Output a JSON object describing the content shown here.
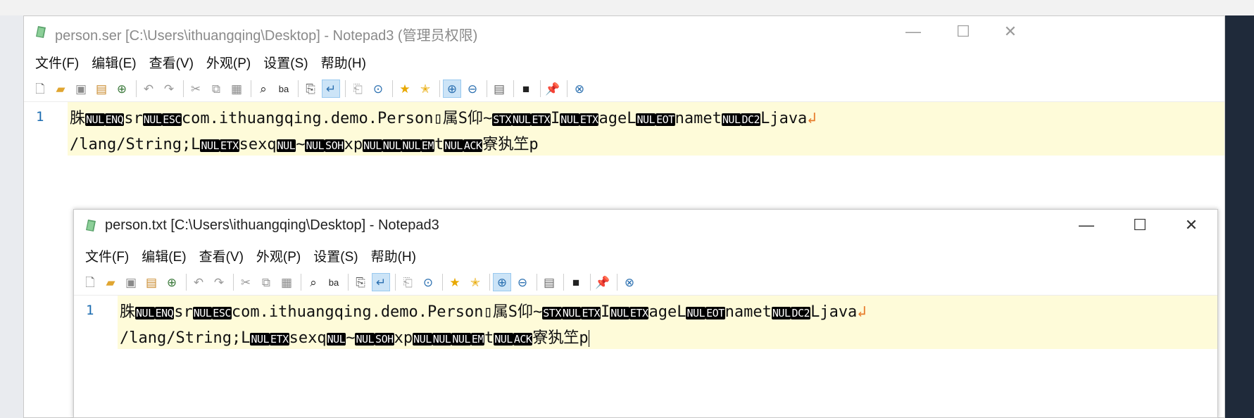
{
  "window_back": {
    "title": "person.ser [C:\\Users\\ithuangqing\\Desktop] - Notepad3  (管理员权限)",
    "line_number": "1"
  },
  "window_front": {
    "title": "person.txt [C:\\Users\\ithuangqing\\Desktop] - Notepad3",
    "line_number": "1"
  },
  "window_controls": {
    "minimize": "—",
    "maximize": "☐",
    "close": "✕"
  },
  "menu": [
    "文件(F)",
    "编辑(E)",
    "查看(V)",
    "外观(P)",
    "设置(S)",
    "帮助(H)"
  ],
  "toolbar_icons": [
    "new-file-icon",
    "open-folder-icon",
    "save-icon",
    "save-as-icon",
    "browse-icon",
    "undo-icon",
    "redo-icon",
    "cut-icon",
    "copy-icon",
    "paste-icon",
    "find-icon",
    "replace-icon",
    "goto-icon",
    "word-wrap-icon",
    "copy-all-icon",
    "find-next-icon",
    "favorites-icon",
    "add-favorite-icon",
    "zoom-in-icon",
    "zoom-out-icon",
    "settings-icon",
    "console-icon",
    "pin-icon",
    "exit-icon"
  ],
  "editor_content": {
    "line1": [
      {
        "t": "t",
        "v": "䏭"
      },
      {
        "t": "c",
        "v": "NUL"
      },
      {
        "t": "c",
        "v": "ENQ"
      },
      {
        "t": "t",
        "v": "sr"
      },
      {
        "t": "c",
        "v": "NUL"
      },
      {
        "t": "c",
        "v": "ESC"
      },
      {
        "t": "t",
        "v": "com.ithuangqing.demo.Person"
      },
      {
        "t": "t",
        "v": "▯属S仰~"
      },
      {
        "t": "c",
        "v": "STX"
      },
      {
        "t": "c",
        "v": "NUL"
      },
      {
        "t": "c",
        "v": "ETX"
      },
      {
        "t": "t",
        "v": "I"
      },
      {
        "t": "c",
        "v": "NUL"
      },
      {
        "t": "c",
        "v": "ETX"
      },
      {
        "t": "t",
        "v": "ageL"
      },
      {
        "t": "c",
        "v": "NUL"
      },
      {
        "t": "c",
        "v": "EOT"
      },
      {
        "t": "t",
        "v": "namet"
      },
      {
        "t": "c",
        "v": "NUL"
      },
      {
        "t": "c",
        "v": "DC2"
      },
      {
        "t": "t",
        "v": "Ljava"
      }
    ],
    "wrap_marker": "↲",
    "line2": [
      {
        "t": "t",
        "v": "/lang/String;L"
      },
      {
        "t": "c",
        "v": "NUL"
      },
      {
        "t": "c",
        "v": "ETX"
      },
      {
        "t": "t",
        "v": "sexq"
      },
      {
        "t": "c",
        "v": "NUL"
      },
      {
        "t": "t",
        "v": "~"
      },
      {
        "t": "c",
        "v": "NUL"
      },
      {
        "t": "c",
        "v": "SOH"
      },
      {
        "t": "t",
        "v": "xp"
      },
      {
        "t": "c",
        "v": "NUL"
      },
      {
        "t": "c",
        "v": "NUL"
      },
      {
        "t": "c",
        "v": "NUL"
      },
      {
        "t": "c",
        "v": "EM"
      },
      {
        "t": "t",
        "v": "t"
      },
      {
        "t": "c",
        "v": "NUL"
      },
      {
        "t": "c",
        "v": "ACK"
      },
      {
        "t": "t",
        "v": "寮犱笁p"
      }
    ]
  },
  "colors": {
    "line_highlight": "#fefbd9",
    "line_number": "#1a6bb0",
    "control_char_bg": "#000000",
    "wrap_marker": "#e77b2a"
  }
}
